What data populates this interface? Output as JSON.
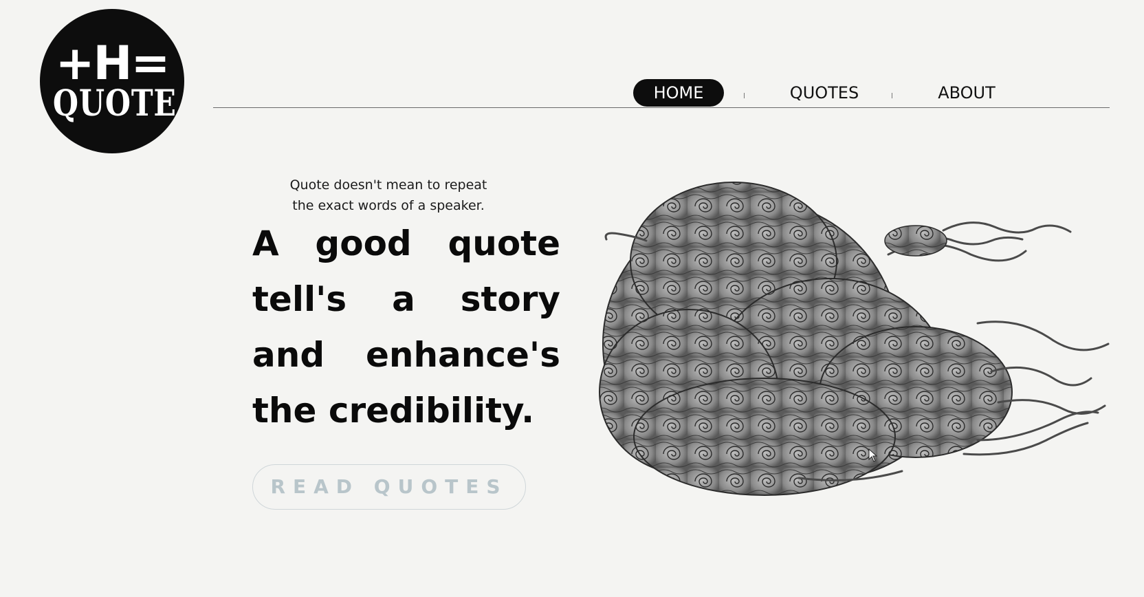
{
  "logo": {
    "line1": "+H=",
    "line2": "QUOTE"
  },
  "nav": {
    "items": [
      {
        "label": "HOME",
        "active": true
      },
      {
        "label": "QUOTES",
        "active": false
      },
      {
        "label": "ABOUT",
        "active": false
      }
    ]
  },
  "hero": {
    "tagline_line1": "Quote doesn't mean to repeat",
    "tagline_line2": "the exact words of a speaker.",
    "headline": [
      [
        "A",
        "good",
        "quote"
      ],
      [
        "tell's",
        "a",
        "story"
      ],
      [
        "and",
        "enhance's"
      ],
      [
        "the credibility."
      ]
    ],
    "cta_label": "READ QUOTES"
  },
  "illustration": {
    "icon": "swirl-cloud-illustration"
  },
  "colors": {
    "background": "#f4f4f2",
    "primary": "#0d0d0d",
    "cta_text": "#b8c5ca",
    "cta_border": "#cfd6d9"
  }
}
